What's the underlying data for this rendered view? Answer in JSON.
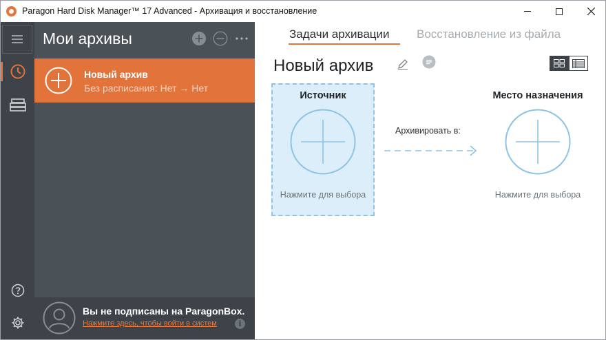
{
  "window": {
    "title": "Paragon Hard Disk Manager™ 17 Advanced - Архивация и восстановление"
  },
  "rail": {
    "items": [
      {
        "icon": "menu-icon"
      },
      {
        "icon": "clock-icon",
        "active": true
      },
      {
        "icon": "drives-icon"
      },
      {
        "icon": "help-icon"
      },
      {
        "icon": "gear-icon"
      }
    ]
  },
  "panel": {
    "title": "Мои архивы",
    "archives": [
      {
        "name": "Новый архив",
        "schedule": "Без расписания: Нет → Нет"
      }
    ],
    "signin": {
      "title": "Вы не подписаны на ParagonBox.",
      "link": "Нажмите здесь, чтобы войти в систем"
    }
  },
  "tabs": {
    "backup": "Задачи архивации",
    "restore": "Восстановление из файла"
  },
  "main": {
    "title": "Новый архив",
    "source": {
      "heading": "Источник",
      "hint": "Нажмите для выбора"
    },
    "arrow_label": "Архивировать в:",
    "destination": {
      "heading": "Место назначения",
      "hint": "Нажмите для выбора"
    }
  },
  "colors": {
    "accent": "#e1733b",
    "rail": "#3d4348",
    "panel": "#4b5257",
    "circle": "#8dc3e4"
  }
}
